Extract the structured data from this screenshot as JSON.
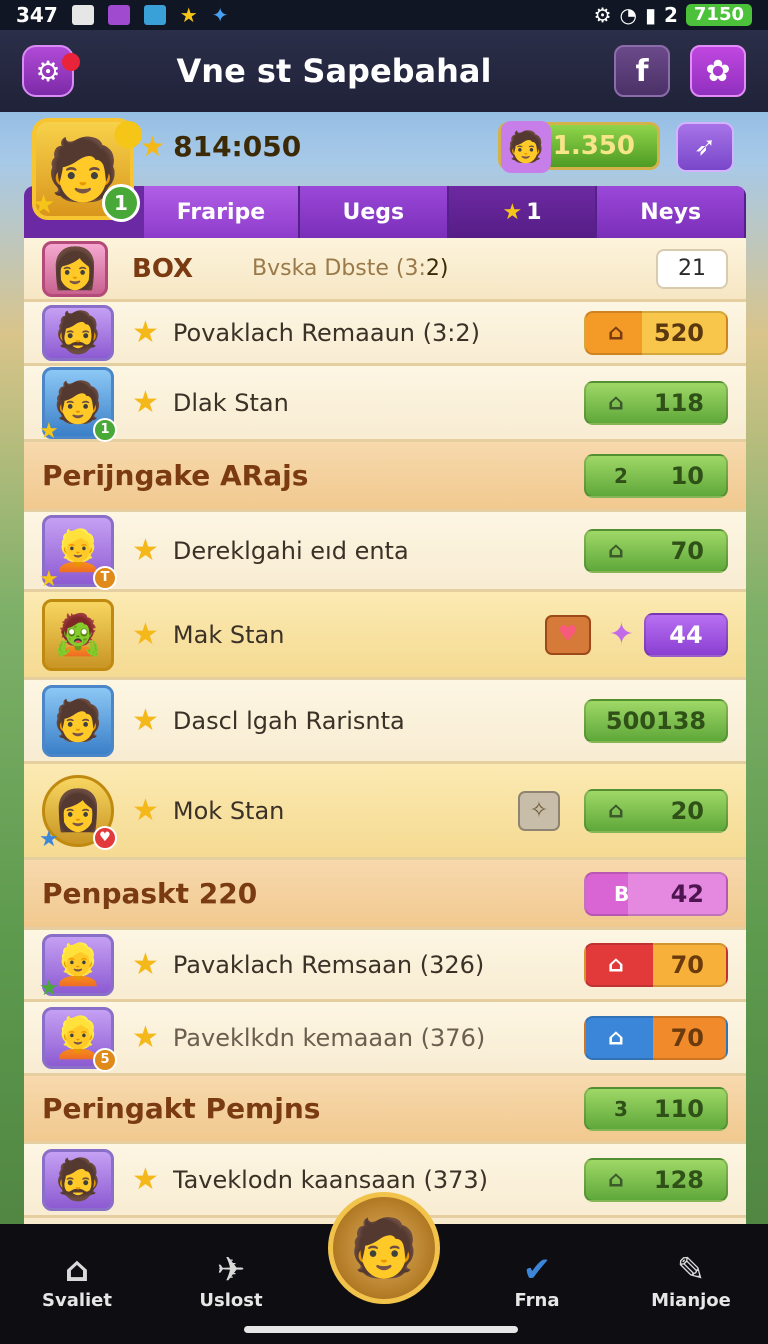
{
  "status_bar": {
    "time": "347",
    "battery": "7150",
    "extra": "2"
  },
  "title_bar": {
    "title": "Vne st Sapebahal",
    "fb_label": "f"
  },
  "header": {
    "score": "814:050",
    "currency": "1.350",
    "level_badge": "1"
  },
  "tabs": [
    {
      "label": "Fraripe"
    },
    {
      "label": "Uegs"
    },
    {
      "label": "1"
    },
    {
      "label": "Neys"
    }
  ],
  "list": {
    "top_row": {
      "label": "BOX",
      "subtitle": "Bvska Dbste (3:",
      "sub_value": "2)",
      "count": "21"
    },
    "rows": [
      {
        "name": "Povaklach Remaaun (3:2)",
        "value": "520"
      },
      {
        "name": "Dlak Stan",
        "value": "118",
        "badge": "1"
      },
      {
        "section": "Perijngake ARajs",
        "pill_label": "2",
        "value": "10"
      },
      {
        "name": "Dereklgahi eıd enta",
        "value": "70"
      },
      {
        "name": "Mak Stan",
        "value": "44"
      },
      {
        "name": "Dascl lgah Rarisnta",
        "value": "500138"
      },
      {
        "name": "Mok Stan",
        "value": "20"
      },
      {
        "section": "Penpaskt 220",
        "pill_label": "B",
        "value": "42"
      },
      {
        "name": "Pavaklach Remsaan (326)",
        "value": "70"
      },
      {
        "name": "Paveklkdn kemaaan (376)",
        "value": "70",
        "badge": "5"
      },
      {
        "section": "Peringakt Pemjns",
        "pill_label": "3",
        "value": "110"
      },
      {
        "name": "Taveklodn kaansaan (373)",
        "value": "128"
      }
    ]
  },
  "bottom_nav": [
    {
      "label": "Svaliet",
      "icon": "home-icon"
    },
    {
      "label": "Uslost",
      "icon": "bird-icon"
    },
    {
      "label": "Frna",
      "icon": "check-icon"
    },
    {
      "label": "Mianjoe",
      "icon": "pen-icon"
    }
  ],
  "colors": {
    "accent": "#9b48d8",
    "panel": "#f8ebcd",
    "green": "#5fa83a"
  }
}
